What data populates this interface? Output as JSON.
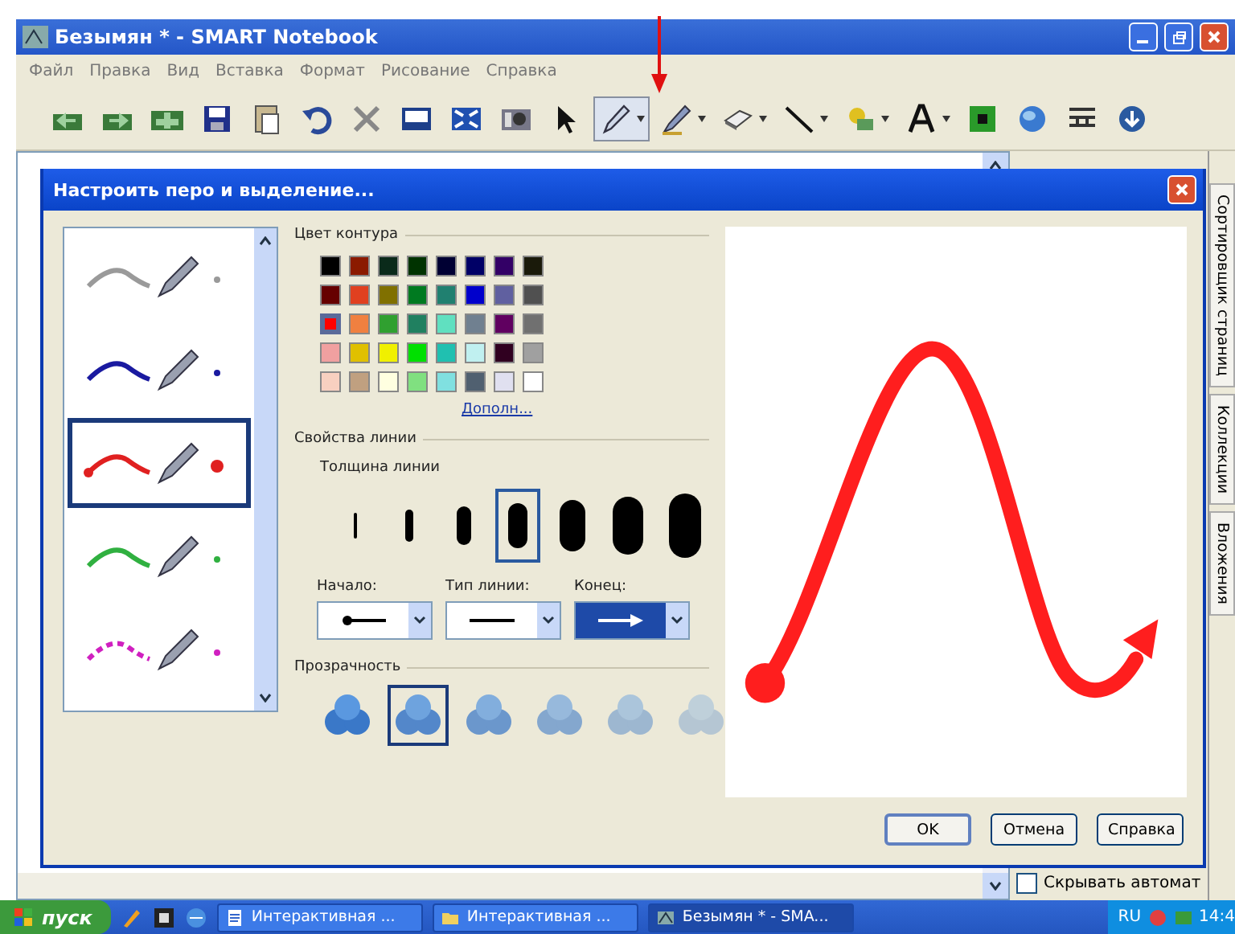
{
  "window": {
    "title": "Безымян * - SMART Notebook"
  },
  "menu": [
    "Файл",
    "Правка",
    "Вид",
    "Вставка",
    "Формат",
    "Рисование",
    "Справка"
  ],
  "toolbar": [
    {
      "kind": "page-back",
      "selected": false,
      "dropdown": false
    },
    {
      "kind": "page-forward",
      "selected": false,
      "dropdown": false
    },
    {
      "kind": "page-add",
      "selected": false,
      "dropdown": false
    },
    {
      "kind": "save",
      "selected": false,
      "dropdown": false
    },
    {
      "kind": "paste",
      "selected": false,
      "dropdown": false
    },
    {
      "kind": "undo",
      "selected": false,
      "dropdown": false
    },
    {
      "kind": "delete",
      "selected": false,
      "dropdown": false
    },
    {
      "kind": "screen-shade",
      "selected": false,
      "dropdown": false
    },
    {
      "kind": "full-screen",
      "selected": false,
      "dropdown": false
    },
    {
      "kind": "camera",
      "selected": false,
      "dropdown": false
    },
    {
      "kind": "select",
      "selected": false,
      "dropdown": false
    },
    {
      "kind": "pen",
      "selected": true,
      "dropdown": true
    },
    {
      "kind": "creative-pen",
      "selected": false,
      "dropdown": true
    },
    {
      "kind": "eraser",
      "selected": false,
      "dropdown": true
    },
    {
      "kind": "line",
      "selected": false,
      "dropdown": true
    },
    {
      "kind": "shape",
      "selected": false,
      "dropdown": true
    },
    {
      "kind": "text",
      "selected": false,
      "dropdown": true
    },
    {
      "kind": "fill",
      "selected": false,
      "dropdown": false
    },
    {
      "kind": "globe",
      "selected": false,
      "dropdown": false
    },
    {
      "kind": "table",
      "selected": false,
      "dropdown": false
    },
    {
      "kind": "more",
      "selected": false,
      "dropdown": false
    }
  ],
  "side_tabs": [
    {
      "label": "Сортировщик страниц"
    },
    {
      "label": "Коллекции"
    },
    {
      "label": "Вложения"
    }
  ],
  "autohide": {
    "label": "Скрывать автомат",
    "checked": false
  },
  "dialog": {
    "title": "Настроить перо и выделение...",
    "presets": [
      {
        "color": "#9a9a9a",
        "kind": "solid",
        "selected": false
      },
      {
        "color": "#1a1aa0",
        "kind": "solid",
        "selected": false
      },
      {
        "color": "#e02020",
        "kind": "dot-start",
        "selected": true
      },
      {
        "color": "#30b040",
        "kind": "solid",
        "selected": false
      },
      {
        "color": "#d020c0",
        "kind": "dashed",
        "selected": false
      }
    ],
    "color_section": "Цвет контура",
    "palette": [
      {
        "color": "#000000",
        "selected": false
      },
      {
        "color": "#8b1a00",
        "selected": false
      },
      {
        "color": "#0a2a1a",
        "selected": false
      },
      {
        "color": "#003300",
        "selected": false
      },
      {
        "color": "#000033",
        "selected": false
      },
      {
        "color": "#000066",
        "selected": false
      },
      {
        "color": "#330066",
        "selected": false
      },
      {
        "color": "#1a1a0a",
        "selected": false
      },
      {
        "color": "#660000",
        "selected": false
      },
      {
        "color": "#e04020",
        "selected": false
      },
      {
        "color": "#807000",
        "selected": false
      },
      {
        "color": "#007a20",
        "selected": false
      },
      {
        "color": "#208070",
        "selected": false
      },
      {
        "color": "#0000cc",
        "selected": false
      },
      {
        "color": "#6060a0",
        "selected": false
      },
      {
        "color": "#505050",
        "selected": false
      },
      {
        "color": "#ff0000",
        "selected": true
      },
      {
        "color": "#f08040",
        "selected": false
      },
      {
        "color": "#30a030",
        "selected": false
      },
      {
        "color": "#208060",
        "selected": false
      },
      {
        "color": "#60e0c0",
        "selected": false
      },
      {
        "color": "#708090",
        "selected": false
      },
      {
        "color": "#600060",
        "selected": false
      },
      {
        "color": "#707070",
        "selected": false
      },
      {
        "color": "#f0a0a0",
        "selected": false
      },
      {
        "color": "#e0c000",
        "selected": false
      },
      {
        "color": "#f0f000",
        "selected": false
      },
      {
        "color": "#00e000",
        "selected": false
      },
      {
        "color": "#20c0b0",
        "selected": false
      },
      {
        "color": "#c0f0f0",
        "selected": false
      },
      {
        "color": "#300020",
        "selected": false
      },
      {
        "color": "#a0a0a0",
        "selected": false
      },
      {
        "color": "#f8d0c0",
        "selected": false
      },
      {
        "color": "#c0a080",
        "selected": false
      },
      {
        "color": "#ffffe0",
        "selected": false
      },
      {
        "color": "#80e080",
        "selected": false
      },
      {
        "color": "#80e0e0",
        "selected": false
      },
      {
        "color": "#506070",
        "selected": false
      },
      {
        "color": "#e0e0f0",
        "selected": false
      },
      {
        "color": "#ffffff",
        "selected": false
      }
    ],
    "more_colors": "Дополн...",
    "line_section": "Свойства линии",
    "thickness_label": "Толщина линии",
    "thickness": [
      {
        "selected": false
      },
      {
        "selected": false
      },
      {
        "selected": false
      },
      {
        "selected": true
      },
      {
        "selected": false
      },
      {
        "selected": false
      },
      {
        "selected": false
      }
    ],
    "start": {
      "label": "Начало:",
      "kind": "dot",
      "focused": false
    },
    "line_type": {
      "label": "Тип линии:",
      "kind": "solid",
      "focused": false
    },
    "end": {
      "label": "Конец:",
      "kind": "arrow",
      "focused": true
    },
    "transparency_label": "Прозрачность",
    "transparency": [
      {
        "selected": false
      },
      {
        "selected": true
      },
      {
        "selected": false
      },
      {
        "selected": false
      },
      {
        "selected": false
      },
      {
        "selected": false
      }
    ],
    "buttons": [
      "OK",
      "Отмена",
      "Справка"
    ]
  },
  "taskbar": {
    "start": "пуск",
    "tasks": [
      {
        "label": "Интерактивная ...",
        "kind": "doc",
        "selected": false
      },
      {
        "label": "Интерактивная ...",
        "kind": "folder",
        "selected": false
      },
      {
        "label": "Безымян * - SMA...",
        "kind": "notebook",
        "selected": true
      }
    ],
    "language": "RU",
    "clock": "14:4"
  }
}
